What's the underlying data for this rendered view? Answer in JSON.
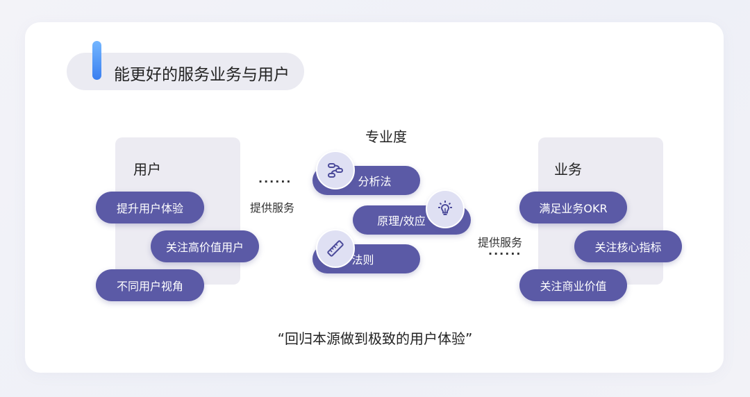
{
  "title": "能更好的服务业务与用户",
  "center": {
    "heading": "专业度",
    "items": [
      {
        "label": "分析法",
        "icon": "flow-icon"
      },
      {
        "label": "原理/效应",
        "icon": "lightbulb-icon"
      },
      {
        "label": "法则",
        "icon": "ruler-icon"
      }
    ]
  },
  "user": {
    "title": "用户",
    "items": [
      "提升用户体验",
      "关注高价值用户",
      "不同用户视角"
    ]
  },
  "business": {
    "title": "业务",
    "items": [
      "满足业务OKR",
      "关注核心指标",
      "关注商业价值"
    ]
  },
  "left_connector": {
    "dots": "······",
    "label": "提供服务"
  },
  "right_connector": {
    "dots": "······",
    "label": "提供服务"
  },
  "quote": "“回归本源做到极致的用户体验”",
  "colors": {
    "pill": "#5b5aa6",
    "accent": "#3a7ff0",
    "panel": "#ecebf2",
    "icon_bg": "#dfe0f3"
  }
}
